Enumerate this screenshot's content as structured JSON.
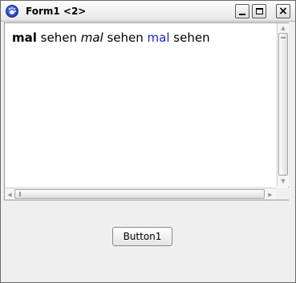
{
  "window": {
    "title": "Form1 <2>",
    "icon": "app-paw-icon",
    "controls": {
      "minimize": "minimize-icon",
      "maximize": "maximize-icon",
      "close": "×"
    }
  },
  "memo": {
    "segments": [
      {
        "text": "mal",
        "style": "bold"
      },
      {
        "text": " sehen ",
        "style": "normal"
      },
      {
        "text": "mal",
        "style": "italic"
      },
      {
        "text": " sehen ",
        "style": "normal"
      },
      {
        "text": "mal",
        "style": "blue"
      },
      {
        "text": " sehen",
        "style": "normal"
      }
    ],
    "accent_color": "#2222bb",
    "scroll_arrows": {
      "up": "▲",
      "down": "▼",
      "left": "◀",
      "right": "▶"
    }
  },
  "button1": {
    "label": "Button1"
  }
}
